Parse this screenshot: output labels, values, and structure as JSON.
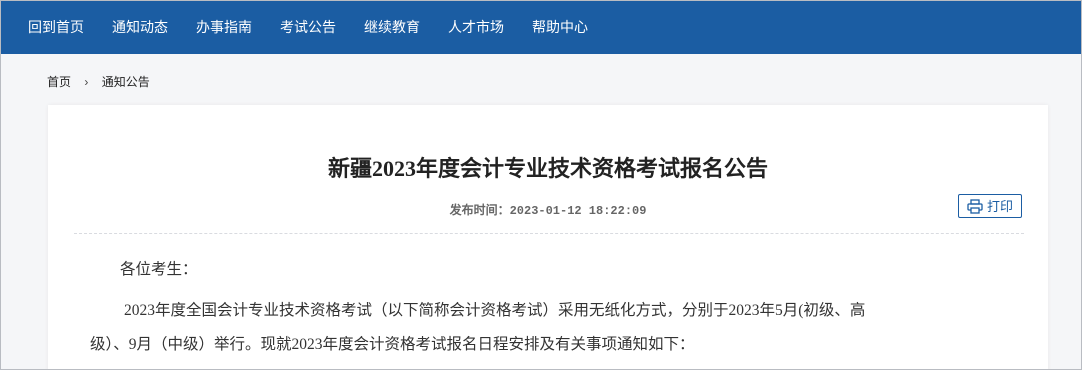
{
  "nav": {
    "items": [
      "回到首页",
      "通知动态",
      "办事指南",
      "考试公告",
      "继续教育",
      "人才市场",
      "帮助中心"
    ]
  },
  "breadcrumb": {
    "home": "首页",
    "separator": "›",
    "current": "通知公告"
  },
  "article": {
    "title": "新疆2023年度会计专业技术资格考试报名公告",
    "publish_label": "发布时间：",
    "publish_time": "2023-01-12 18:22:09",
    "print_label": "打印",
    "greeting": "各位考生：",
    "paragraph_line1": "2023年度全国会计专业技术资格考试（以下简称会计资格考试）采用无纸化方式，分别于2023年5月(初级、高",
    "paragraph_line2": "级）、9月（中级）举行。现就2023年度会计资格考试报名日程安排及有关事项通知如下："
  },
  "colors": {
    "nav_bg": "#1b5da3",
    "nav_text": "#ffffff",
    "accent": "#1b5da3",
    "page_bg": "#f5f6f8"
  },
  "icons": {
    "print": "printer-icon"
  }
}
